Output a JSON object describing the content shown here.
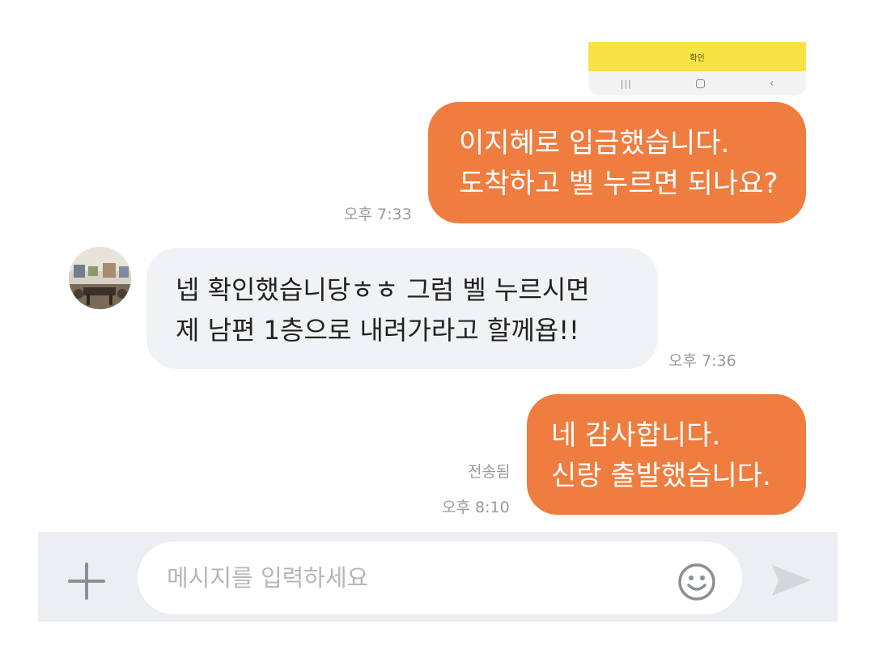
{
  "top_screenshot": {
    "confirm_label": "확인",
    "nav_recent_icon": "recent-apps-icon",
    "nav_home_icon": "home-icon",
    "nav_back_icon": "back-icon"
  },
  "messages": [
    {
      "direction": "outgoing",
      "lines": [
        "이지혜로 입금했습니다.",
        "도착하고 벨 누르면 되나요?"
      ],
      "time": "오후 7:33"
    },
    {
      "direction": "incoming",
      "lines": [
        "넵 확인했습니당ㅎㅎ 그럼 벨 누르시면",
        "제 남편 1층으로 내려가라고 할께욥!!"
      ],
      "time": "오후 7:36"
    },
    {
      "direction": "outgoing",
      "lines": [
        "네 감사합니다.",
        "신랑 출발했습니다."
      ],
      "status": "전송됨",
      "time": "오후 8:10"
    }
  ],
  "input_bar": {
    "placeholder": "메시지를 입력하세요",
    "plus_icon": "plus-icon",
    "emoji_icon": "smiley-icon",
    "send_icon": "send-icon"
  },
  "colors": {
    "outgoing_bubble": "#ee7d3f",
    "incoming_bubble": "#f1f2f5",
    "confirm_yellow": "#f7e444",
    "input_bar_bg": "#eceef2"
  }
}
